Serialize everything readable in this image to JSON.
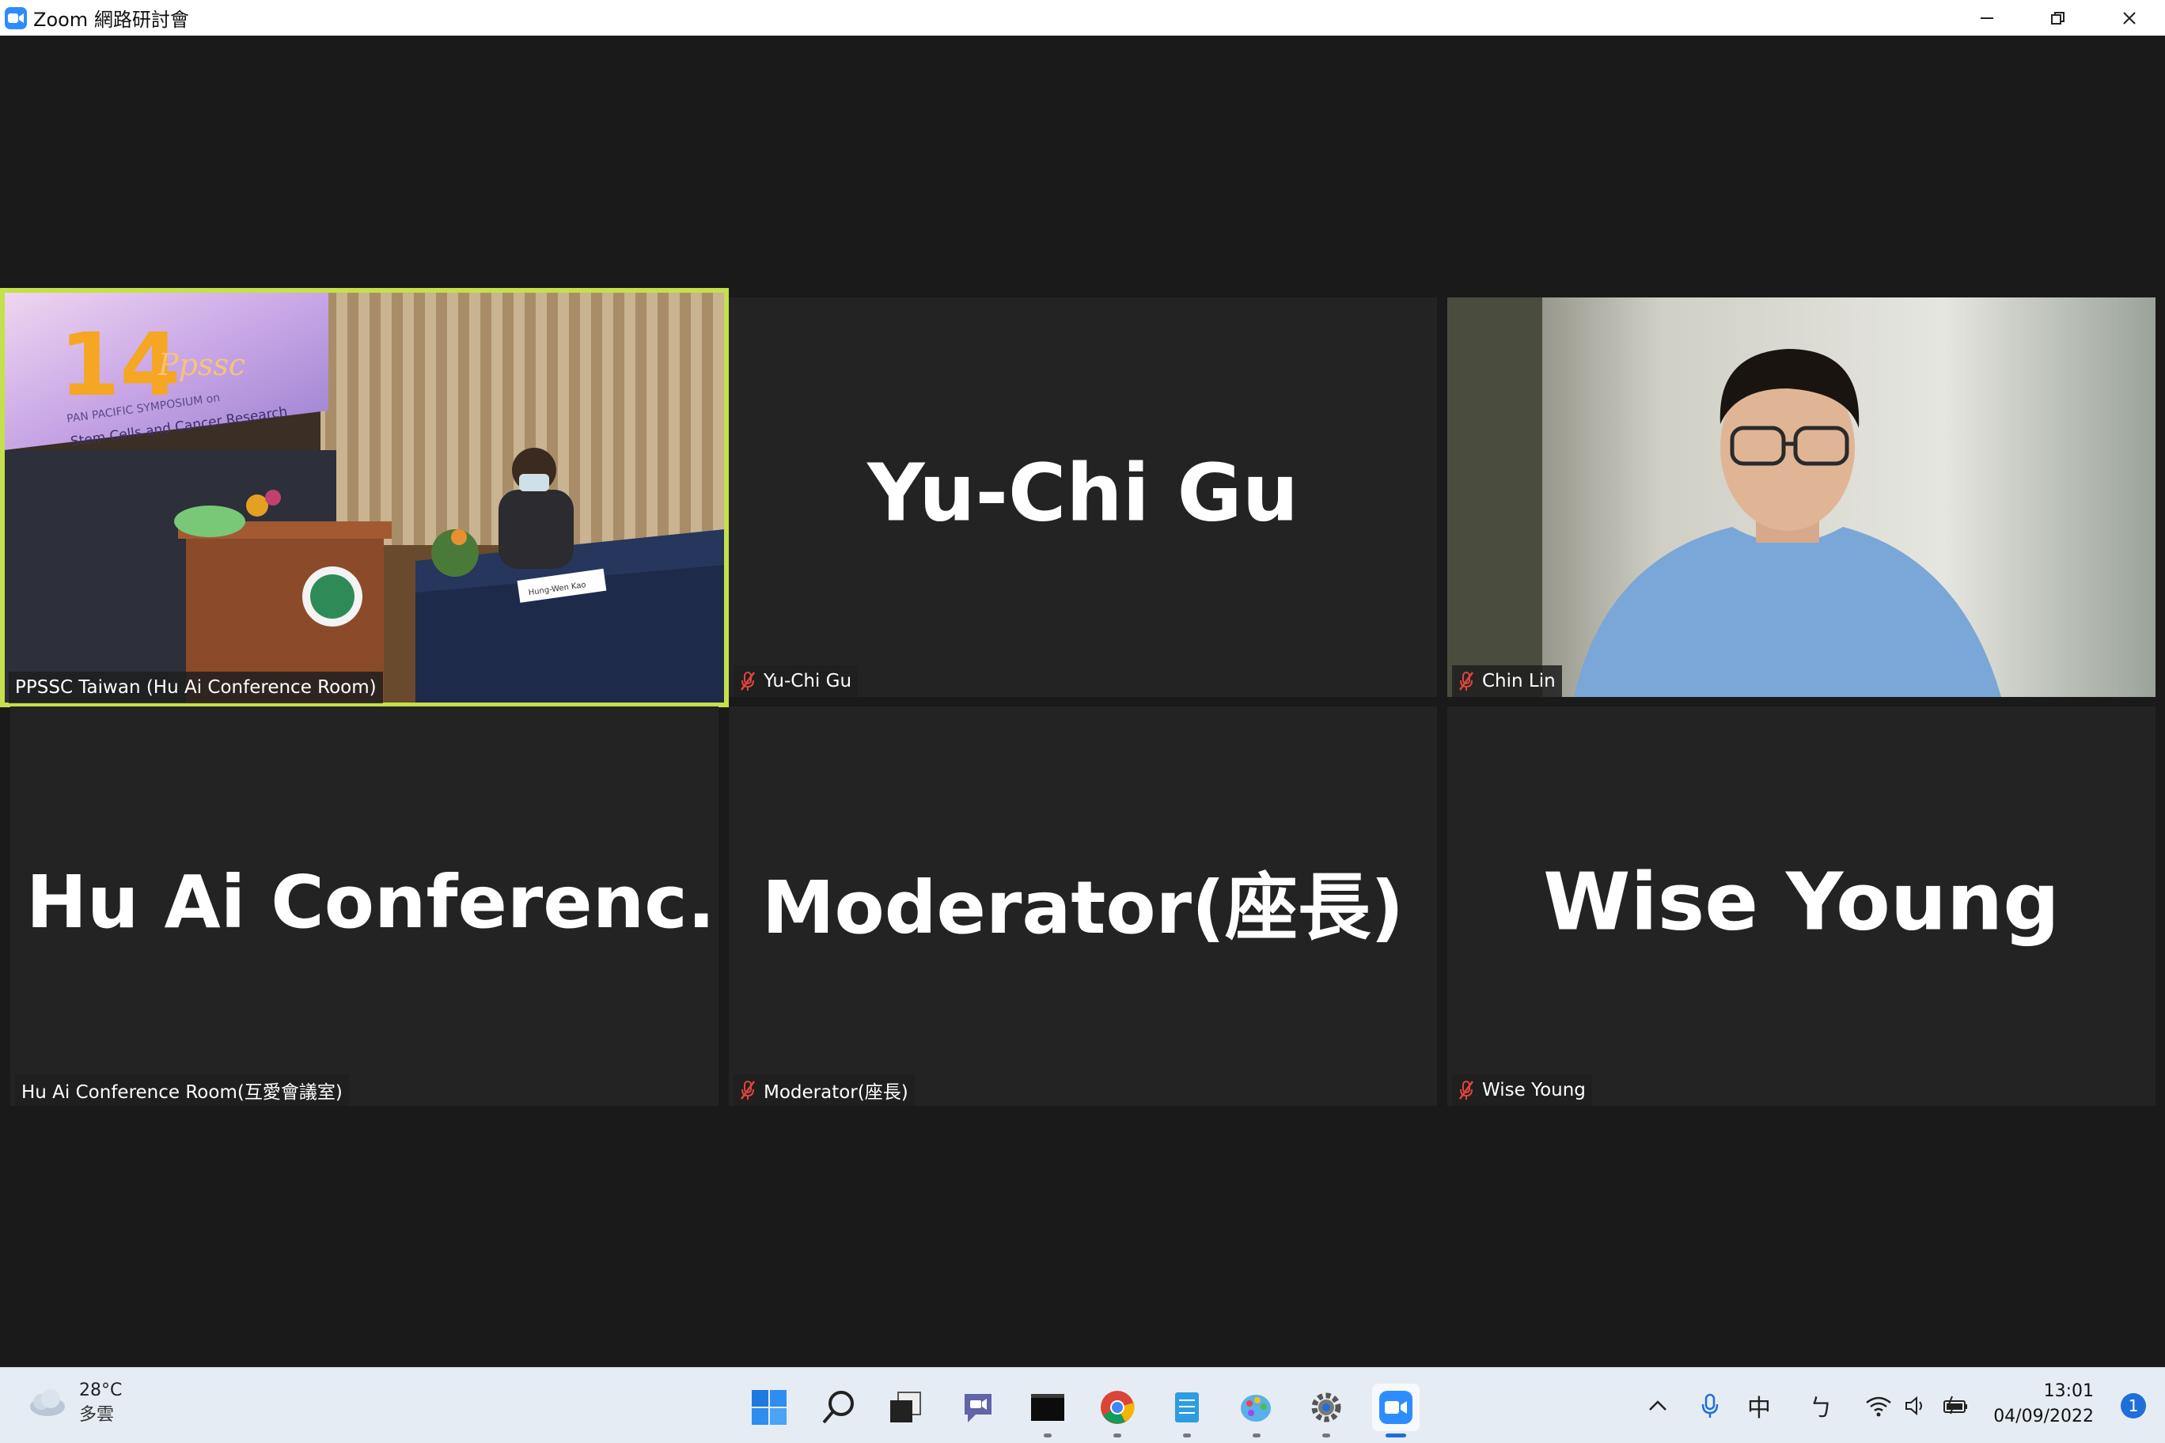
{
  "window": {
    "title": "Zoom 網路研討會",
    "icon": "zoom-icon",
    "controls": [
      "minimize",
      "restore",
      "close"
    ]
  },
  "tiles": [
    {
      "id": "tile-ppssc",
      "label": "PPSSC Taiwan (Hu Ai Conference Room)",
      "muted": false,
      "active_speaker": true,
      "video": true,
      "video_description": "conference room with PPSSC banner"
    },
    {
      "id": "tile-yuchi",
      "big_name": "Yu-Chi Gu",
      "label": "Yu-Chi Gu",
      "muted": true,
      "video": false
    },
    {
      "id": "tile-chinlin",
      "label": "Chin Lin",
      "muted": true,
      "video": true
    },
    {
      "id": "tile-huai",
      "big_name": "Hu Ai Conferenc...",
      "label": "Hu Ai Conference Room(互愛會議室)",
      "muted": false,
      "video": false
    },
    {
      "id": "tile-moderator",
      "big_name": "Moderator(座長)",
      "label": "Moderator(座長)",
      "muted": true,
      "video": false
    },
    {
      "id": "tile-wise",
      "big_name": "Wise Young",
      "label": "Wise Young",
      "muted": true,
      "video": false
    }
  ],
  "banner": {
    "number": "14",
    "brand": "Ppssc",
    "line1": "PAN PACIFIC SYMPOSIUM on",
    "line2": "Stem Cells and Cancer Research",
    "nameplate": "Hung-Wen Kao"
  },
  "taskbar": {
    "weather": {
      "temp": "28°C",
      "condition": "多雲",
      "icon": "cloud-icon"
    },
    "apps": [
      {
        "name": "start-icon",
        "open": false
      },
      {
        "name": "search-icon",
        "open": false
      },
      {
        "name": "task-view-icon",
        "open": false
      },
      {
        "name": "teams-chat-icon",
        "open": false
      },
      {
        "name": "terminal-icon",
        "open": true
      },
      {
        "name": "chrome-icon",
        "open": true
      },
      {
        "name": "notepad-icon",
        "open": true
      },
      {
        "name": "paint-icon",
        "open": true
      },
      {
        "name": "settings-icon",
        "open": true
      },
      {
        "name": "zoom-icon",
        "open": true,
        "active": true
      }
    ],
    "tray": {
      "chevron": "chevron-up-icon",
      "mic": "microphone-icon",
      "ime": "中",
      "ime2": "ㄅ",
      "wifi": "wifi-icon",
      "volume": "speaker-icon",
      "battery": "battery-icon"
    },
    "clock": {
      "time": "13:01",
      "date": "04/09/2022"
    },
    "notifications": "1"
  },
  "colors": {
    "active_speaker_border": "#c4e04a",
    "muted_mic": "#e0443e",
    "zoom_blue": "#2d8cff",
    "tile_bg": "#232323",
    "stage_bg": "#1a1a1a"
  }
}
